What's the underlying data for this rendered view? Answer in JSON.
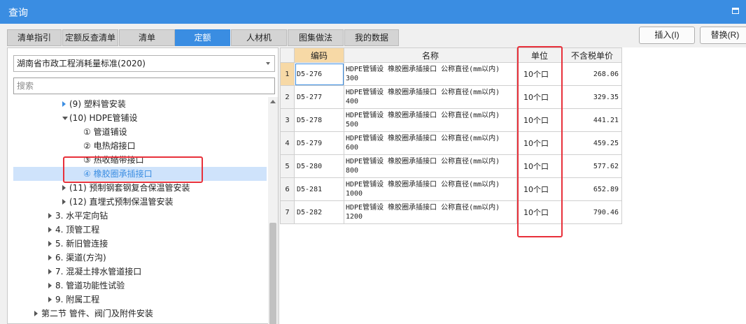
{
  "window": {
    "title": "查询"
  },
  "tabs": [
    "清单指引",
    "定额反查清单",
    "清单",
    "定额",
    "人材机",
    "图集做法",
    "我的数据"
  ],
  "active_tab": 3,
  "buttons": {
    "insert": "插入(I)",
    "replace": "替换(R)"
  },
  "left_panel": {
    "standard_value": "湖南省市政工程消耗量标准(2020)",
    "search_placeholder": "搜索",
    "tree": [
      {
        "label": "(9) 塑料管安装",
        "expander": "collapsed",
        "selected": false
      },
      {
        "label": "(10) HDPE管铺设",
        "expander": "expanded",
        "selected": false
      },
      {
        "label": "① 管道铺设",
        "expander": "none",
        "selected": false
      },
      {
        "label": "② 电热熔接口",
        "expander": "none",
        "selected": false
      },
      {
        "label": "③ 热收缩带接口",
        "expander": "none",
        "selected": false
      },
      {
        "label": "④ 橡胶圈承插接口",
        "expander": "none",
        "selected": true
      },
      {
        "label": "(11) 预制钢套钢复合保温管安装",
        "expander": "collapsed",
        "selected": false
      },
      {
        "label": "(12) 直埋式预制保温管安装",
        "expander": "collapsed",
        "selected": false
      },
      {
        "label": "3. 水平定向钻",
        "expander": "collapsed",
        "selected": false
      },
      {
        "label": "4. 顶管工程",
        "expander": "collapsed",
        "selected": false
      },
      {
        "label": "5. 新旧管连接",
        "expander": "collapsed",
        "selected": false
      },
      {
        "label": "6. 渠道(方沟)",
        "expander": "collapsed",
        "selected": false
      },
      {
        "label": "7. 混凝土排水管道接口",
        "expander": "collapsed",
        "selected": false
      },
      {
        "label": "8. 管道功能性试验",
        "expander": "collapsed",
        "selected": false
      },
      {
        "label": "9. 附属工程",
        "expander": "collapsed",
        "selected": false
      },
      {
        "label": "第二节 管件、阀门及附件安装",
        "expander": "collapsed",
        "selected": false
      }
    ]
  },
  "table": {
    "columns": {
      "code": "编码",
      "name": "名称",
      "unit": "单位",
      "price": "不含税单价"
    },
    "rows": [
      {
        "no": "1",
        "code": "D5-276",
        "name": "HDPE管铺设 橡胶圈承插接口 公称直径(mm以内) 300",
        "unit": "10个口",
        "price": "268.06"
      },
      {
        "no": "2",
        "code": "D5-277",
        "name": "HDPE管铺设 橡胶圈承插接口 公称直径(mm以内) 400",
        "unit": "10个口",
        "price": "329.35"
      },
      {
        "no": "3",
        "code": "D5-278",
        "name": "HDPE管铺设 橡胶圈承插接口 公称直径(mm以内) 500",
        "unit": "10个口",
        "price": "441.21"
      },
      {
        "no": "4",
        "code": "D5-279",
        "name": "HDPE管铺设 橡胶圈承插接口 公称直径(mm以内) 600",
        "unit": "10个口",
        "price": "459.25"
      },
      {
        "no": "5",
        "code": "D5-280",
        "name": "HDPE管铺设 橡胶圈承插接口 公称直径(mm以内) 800",
        "unit": "10个口",
        "price": "577.62"
      },
      {
        "no": "6",
        "code": "D5-281",
        "name": "HDPE管铺设 橡胶圈承插接口 公称直径(mm以内) 1000",
        "unit": "10个口",
        "price": "652.89"
      },
      {
        "no": "7",
        "code": "D5-282",
        "name": "HDPE管铺设 橡胶圈承插接口 公称直径(mm以内) 1200",
        "unit": "10个口",
        "price": "790.46"
      }
    ]
  },
  "colors": {
    "titlebar": "#3a8de2",
    "active_tab": "#3a8de2",
    "highlight": "#e8303a",
    "selected_row": "#cfe3fb",
    "code_header": "#f7d9a6"
  }
}
